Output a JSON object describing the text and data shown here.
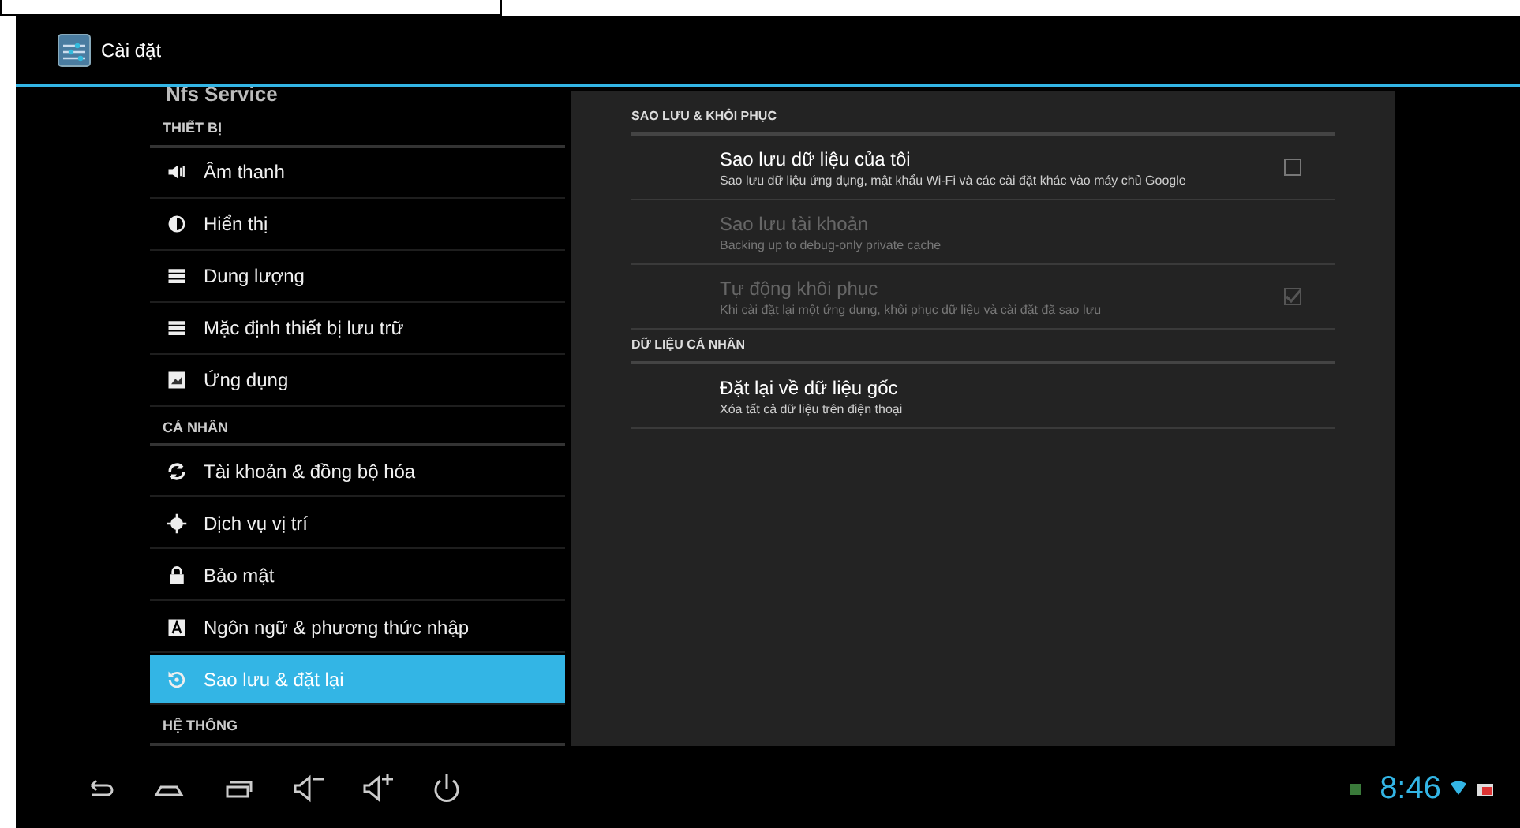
{
  "header": {
    "title": "Cài đặt"
  },
  "sidebar": {
    "items": [
      {
        "kind": "item",
        "label": "Nfs Service",
        "selected": false
      },
      {
        "kind": "header",
        "label": "THIẾT BỊ"
      },
      {
        "kind": "item",
        "label": "Âm thanh",
        "selected": false
      },
      {
        "kind": "item",
        "label": "Hiển thị",
        "selected": false
      },
      {
        "kind": "item",
        "label": "Dung lượng",
        "selected": false
      },
      {
        "kind": "item",
        "label": "Mặc định thiết bị lưu trữ",
        "selected": false
      },
      {
        "kind": "item",
        "label": "Ứng dụng",
        "selected": false
      },
      {
        "kind": "header",
        "label": "CÁ NHÂN"
      },
      {
        "kind": "item",
        "label": "Tài khoản & đồng bộ hóa",
        "selected": false
      },
      {
        "kind": "item",
        "label": "Dịch vụ vị trí",
        "selected": false
      },
      {
        "kind": "item",
        "label": "Bảo mật",
        "selected": false
      },
      {
        "kind": "item",
        "label": "Ngôn ngữ & phương thức nhập",
        "selected": false
      },
      {
        "kind": "item",
        "label": "Sao lưu & đặt lại",
        "selected": true
      },
      {
        "kind": "header",
        "label": "HỆ THỐNG"
      }
    ]
  },
  "sections": [
    {
      "title": "SAO LƯU & KHÔI PHỤC",
      "prefs": [
        {
          "kind": "checkbox",
          "title": "Sao lưu dữ liệu của tôi",
          "summary": "Sao lưu dữ liệu ứng dụng, mật khẩu Wi-Fi và các cài đặt khác vào máy chủ Google",
          "disabled": false,
          "checked": false
        },
        {
          "kind": "plain",
          "title": "Sao lưu tài khoản",
          "summary": "Backing up to debug-only private cache",
          "disabled": true
        },
        {
          "kind": "checkbox",
          "title": "Tự động khôi phục",
          "summary": "Khi cài đặt lại một ứng dụng, khôi phục dữ liệu và cài đặt đã sao lưu",
          "disabled": true,
          "checked": true
        }
      ]
    },
    {
      "title": "DỮ LIỆU CÁ NHÂN",
      "prefs": [
        {
          "kind": "plain",
          "title": "Đặt lại về dữ liệu gốc",
          "summary": "Xóa tất cả dữ liệu trên điện thoại",
          "disabled": false
        }
      ]
    }
  ],
  "status_bar": {
    "time": "8:46"
  }
}
